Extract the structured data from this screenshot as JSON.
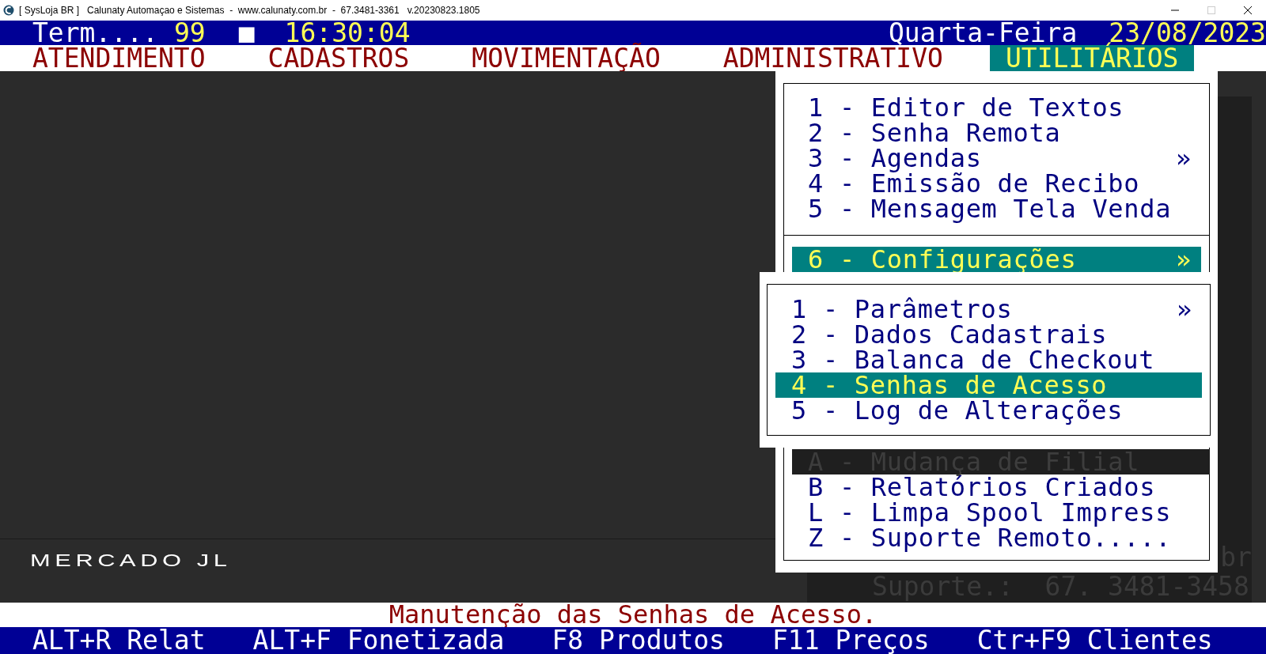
{
  "window": {
    "title": "[ SysLoja BR ]   Calunaty Automaçao e Sistemas  -  www.calunaty.com.br  -  67.3481-3361   v.20230823.1805"
  },
  "header": {
    "terminal_label": "Term....",
    "terminal_number": "99",
    "indicator": "■",
    "time": "16:30:04",
    "weekday": "Quarta-Feira",
    "date": "23/08/2023"
  },
  "menu_bar": [
    {
      "label": "ATENDIMENTO",
      "selected": false
    },
    {
      "label": "CADASTROS",
      "selected": false
    },
    {
      "label": "MOVIMENTAÇÃO",
      "selected": false
    },
    {
      "label": "ADMINISTRATIVO",
      "selected": false
    },
    {
      "label": "UTILITÁRIOS",
      "selected": true
    }
  ],
  "menu": {
    "items": [
      {
        "kind": "item",
        "label": "1 - Editor de Textos",
        "selected": false
      },
      {
        "kind": "item",
        "label": "2 - Senha Remota",
        "selected": false
      },
      {
        "kind": "item",
        "label": "3 - Agendas",
        "arrow": "»",
        "selected": false
      },
      {
        "kind": "item",
        "label": "4 - Emissão de Recibo",
        "selected": false
      },
      {
        "kind": "item",
        "label": "5 - Mensagem Tela Venda",
        "selected": false
      },
      {
        "kind": "separator"
      },
      {
        "kind": "item",
        "label": "6 - Configurações",
        "arrow": "»",
        "selected": true,
        "expanded": true
      },
      {
        "kind": "item",
        "label": "A - Mudança de Filial",
        "selected": false,
        "dimmed": true
      },
      {
        "kind": "item",
        "label": "B - Relatórios Criados",
        "selected": false
      },
      {
        "kind": "item",
        "label": "L - Limpa Spool Impress",
        "selected": false
      },
      {
        "kind": "item",
        "label": "Z - Suporte Remoto.....",
        "selected": false
      }
    ]
  },
  "submenu": {
    "items": [
      {
        "label": "1 - Parâmetros",
        "arrow": "»",
        "selected": false
      },
      {
        "label": "2 - Dados Cadastrais",
        "selected": false
      },
      {
        "label": "3 - Balanca de Checkout",
        "selected": false
      },
      {
        "label": "4 - Senhas de Acesso",
        "selected": true
      },
      {
        "label": "5 - Log de Alterações",
        "selected": false
      }
    ]
  },
  "company_name": "MERCADO JL",
  "info_panel": {
    "line_1": "br",
    "line_2": "Suporte.:  67. 3481-3458"
  },
  "status_message": "Manutenção das Senhas de Acesso.",
  "shortcuts": [
    "ALT+R Relat",
    "ALT+F Fonetizada",
    "F8 Produtos",
    "F11 Preços",
    "Ctr+F9 Clientes"
  ]
}
